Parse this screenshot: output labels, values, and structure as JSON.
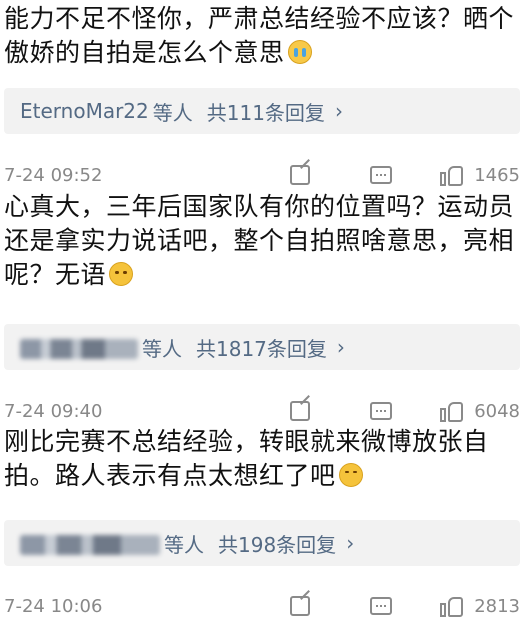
{
  "comments": [
    {
      "text": "能力不足不怪你，严肃总结经验不应该？晒个傲娇的自拍是怎么个意思",
      "emoji": "crying-face",
      "replies": {
        "names": "EternoMar22",
        "who": "等人",
        "total": "共111条回复",
        "chevron": "›"
      },
      "time": "7-24 09:52",
      "likes": "1465"
    },
    {
      "text": "心真大，三年后国家队有你的位置吗？运动员还是拿实力说话吧，整个自拍照啥意思，亮相呢？无语",
      "emoji": "frowning-face",
      "replies": {
        "who": "等人",
        "total": "共1817条回复",
        "chevron": "›"
      },
      "time": "7-24 09:40",
      "likes": "6048"
    },
    {
      "text": "刚比完赛不总结经验，转眼就来微博放张自拍。路人表示有点太想红了吧",
      "emoji": "sweat-smile-face",
      "replies": {
        "who": "等人",
        "total": "共198条回复",
        "chevron": "›"
      },
      "time": "7-24 10:06",
      "likes": "2813"
    }
  ]
}
